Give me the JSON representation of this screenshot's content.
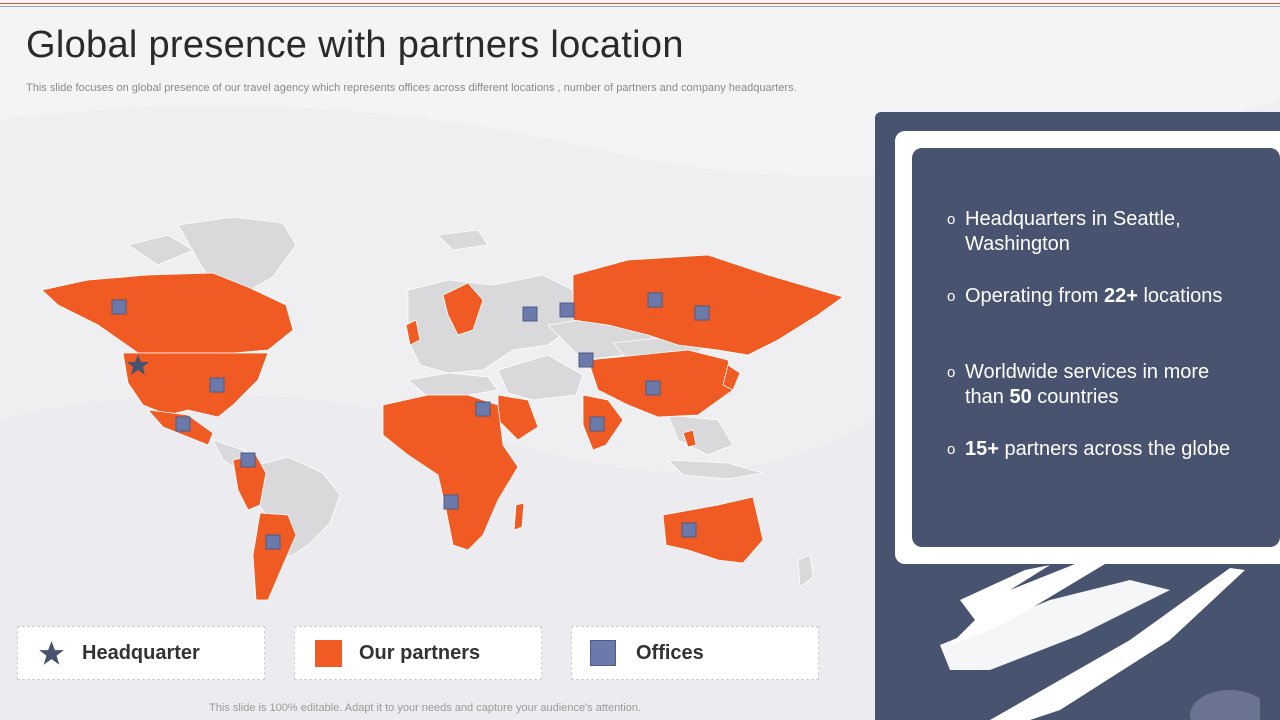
{
  "header": {
    "title": "Global presence with partners location",
    "subtitle": "This slide focuses on global presence of our travel  agency which represents offices across different locations , number of partners and company headquarters."
  },
  "colors": {
    "partner": "#f05a23",
    "office": "#6b7aaa",
    "land": "#d9d9dc",
    "headquarter_star": "#48536f",
    "panel": "#48536f"
  },
  "legend": [
    {
      "label": "Headquarter",
      "icon": "star-icon"
    },
    {
      "label": "Our partners",
      "icon": "orange-square-icon"
    },
    {
      "label": "Offices",
      "icon": "blue-square-icon"
    }
  ],
  "highlights": [
    {
      "pre": "Headquarters  in Seattle, Washington",
      "bold": "",
      "post": ""
    },
    {
      "pre": "Operating  from ",
      "bold": "22+",
      "post": " locations"
    },
    {
      "pre": "Worldwide services in more than ",
      "bold": "50",
      "post": " countries"
    },
    {
      "pre": "",
      "bold": "15+",
      "post": " partners across the globe"
    }
  ],
  "footer": "This slide is 100% editable. Adapt it to your needs and capture your audience's attention."
}
